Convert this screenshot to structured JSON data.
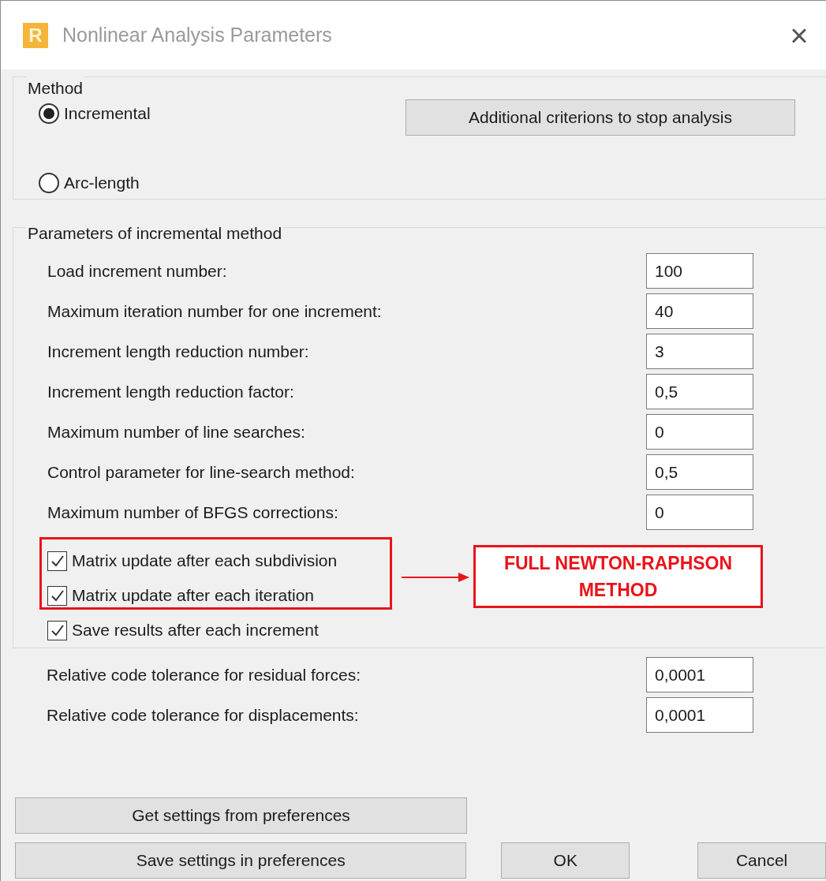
{
  "window": {
    "icon_letter": "R",
    "title": "Nonlinear Analysis Parameters",
    "close": "×"
  },
  "method": {
    "legend": "Method",
    "options": [
      {
        "label": "Incremental",
        "selected": true
      },
      {
        "label": "Arc-length",
        "selected": false
      }
    ],
    "button": "Additional criterions to stop analysis"
  },
  "parameters": {
    "legend": "Parameters of incremental method",
    "fields": [
      {
        "label": "Load increment number:",
        "value": "100"
      },
      {
        "label": "Maximum iteration number for one increment:",
        "value": "40"
      },
      {
        "label": "Increment length reduction number:",
        "value": "3"
      },
      {
        "label": "Increment length reduction factor:",
        "value": "0,5"
      },
      {
        "label": "Maximum number of line searches:",
        "value": "0"
      },
      {
        "label": "Control parameter for line-search method:",
        "value": "0,5"
      },
      {
        "label": "Maximum number of BFGS corrections:",
        "value": "0"
      }
    ],
    "checkboxes": [
      {
        "label": "Matrix update after each subdivision",
        "checked": true
      },
      {
        "label": "Matrix update after each iteration",
        "checked": true
      },
      {
        "label": "Save results after each increment",
        "checked": true
      }
    ]
  },
  "tolerances": [
    {
      "label": "Relative code tolerance for residual forces:",
      "value": "0,0001"
    },
    {
      "label": "Relative code tolerance for displacements:",
      "value": "0,0001"
    }
  ],
  "annotation": {
    "text": "FULL NEWTON-RAPHSON METHOD"
  },
  "buttons": {
    "get_settings": "Get settings from preferences",
    "save_settings": "Save settings in preferences",
    "ok": "OK",
    "cancel": "Cancel"
  }
}
